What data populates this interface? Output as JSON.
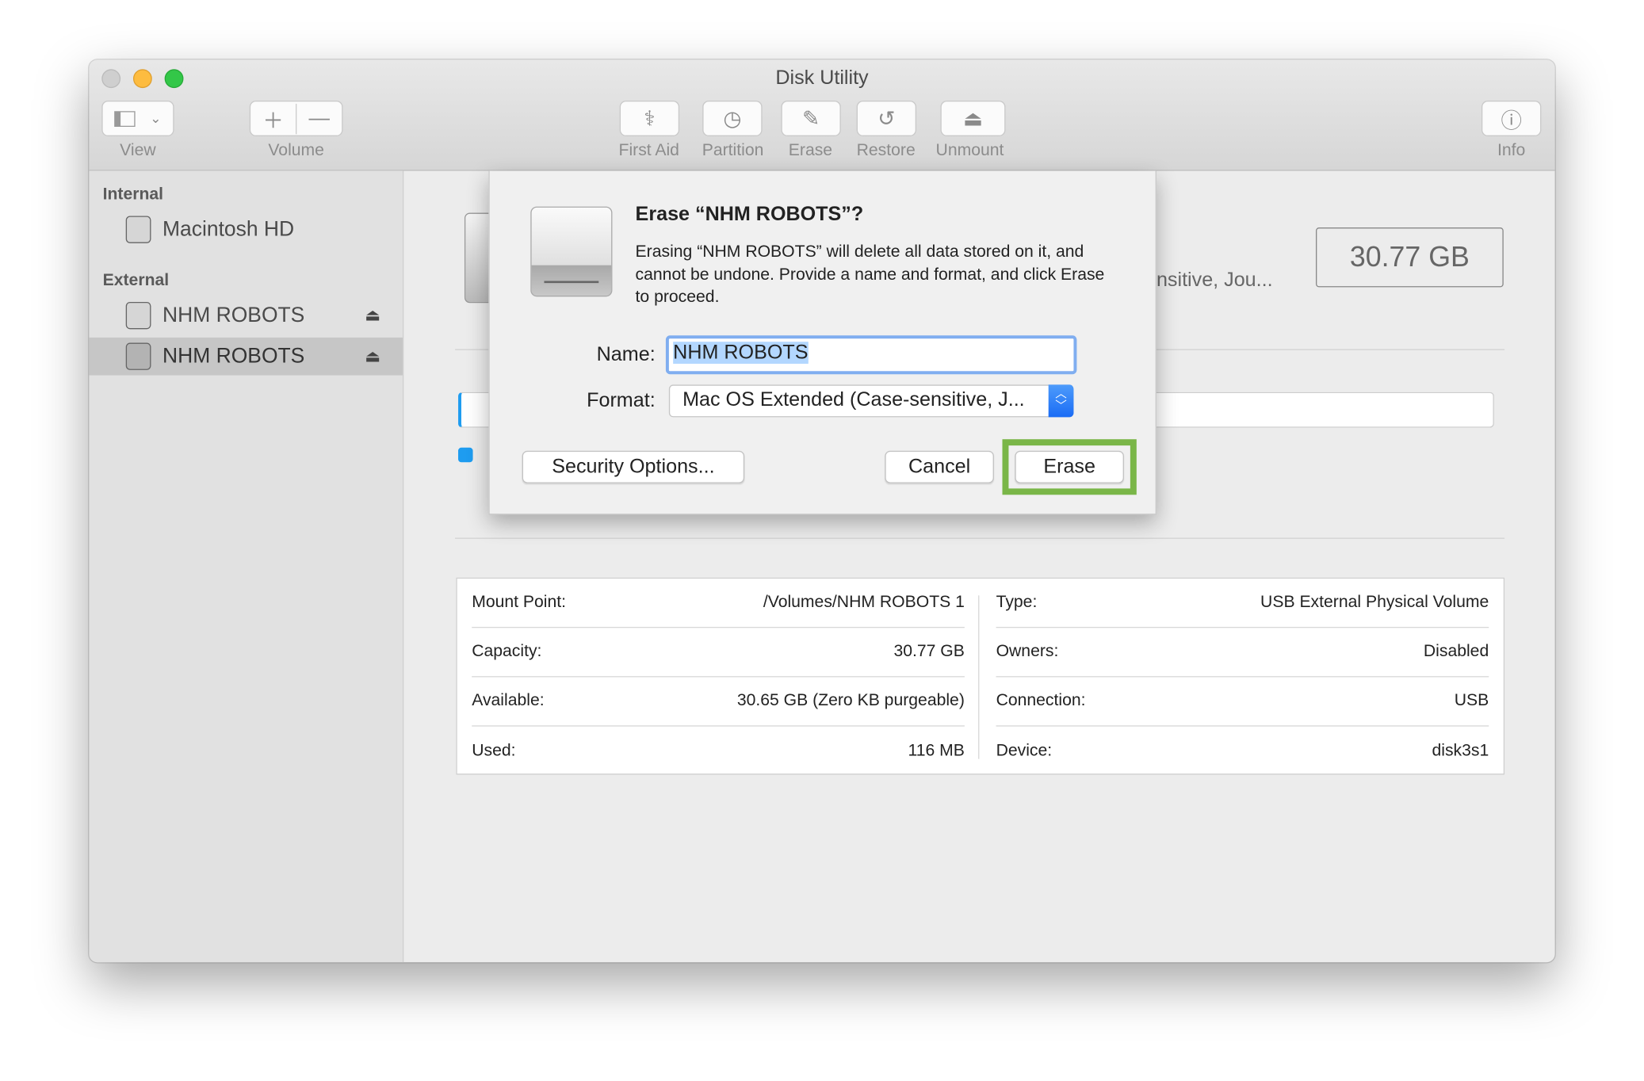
{
  "window": {
    "title": "Disk Utility"
  },
  "toolbar": {
    "view": "View",
    "volume": "Volume",
    "first_aid": "First Aid",
    "partition": "Partition",
    "erase": "Erase",
    "restore": "Restore",
    "unmount": "Unmount",
    "info": "Info"
  },
  "sidebar": {
    "internal_label": "Internal",
    "external_label": "External",
    "items": [
      {
        "label": "Macintosh HD"
      },
      {
        "label": "NHM ROBOTS"
      },
      {
        "label": "NHM ROBOTS",
        "selected": true
      }
    ]
  },
  "main": {
    "format_partial": "nsitive, Jou...",
    "capacity_badge": "30.77 GB",
    "info": {
      "left": [
        {
          "label": "Mount Point:",
          "value": "/Volumes/NHM ROBOTS 1"
        },
        {
          "label": "Capacity:",
          "value": "30.77 GB"
        },
        {
          "label": "Available:",
          "value": "30.65 GB (Zero KB purgeable)"
        },
        {
          "label": "Used:",
          "value": "116 MB"
        }
      ],
      "right": [
        {
          "label": "Type:",
          "value": "USB External Physical Volume"
        },
        {
          "label": "Owners:",
          "value": "Disabled"
        },
        {
          "label": "Connection:",
          "value": "USB"
        },
        {
          "label": "Device:",
          "value": "disk3s1"
        }
      ]
    },
    "usage_color": "#1e9cf0"
  },
  "dialog": {
    "title": "Erase “NHM ROBOTS”?",
    "message": "Erasing “NHM ROBOTS” will delete all data stored on it, and cannot be undone. Provide a name and format, and click Erase to proceed.",
    "name_label": "Name:",
    "name_value": "NHM ROBOTS",
    "format_label": "Format:",
    "format_value": "Mac OS Extended (Case-sensitive, J...",
    "security_button": "Security Options...",
    "cancel_button": "Cancel",
    "erase_button": "Erase",
    "highlight_color": "#7ab648"
  }
}
